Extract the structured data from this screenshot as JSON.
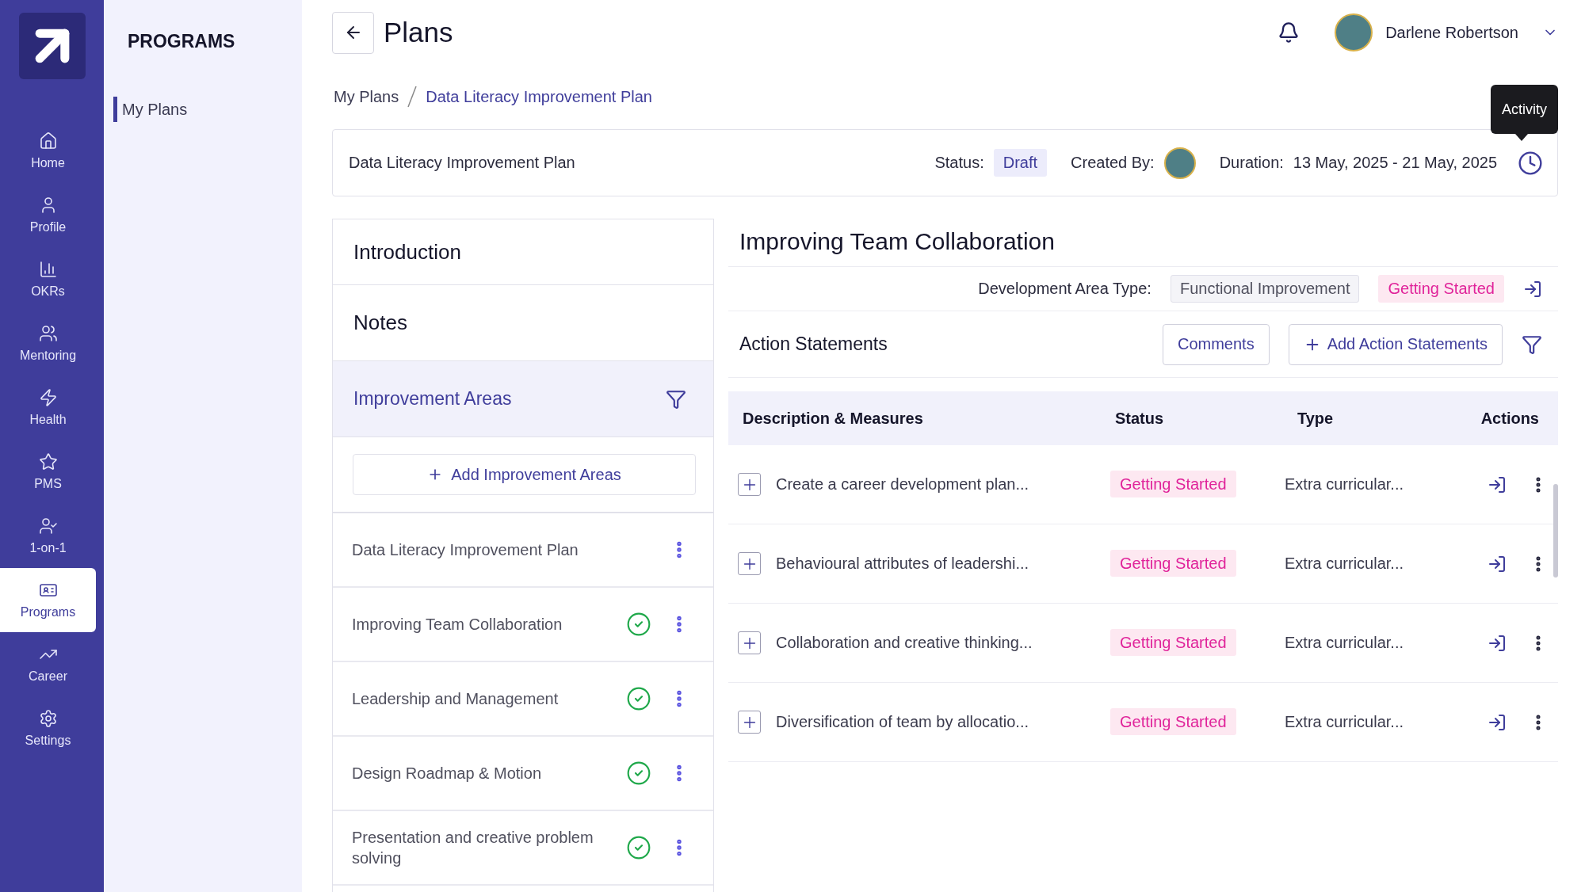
{
  "nav": [
    {
      "label": "Home",
      "selected": false
    },
    {
      "label": "Profile",
      "selected": false
    },
    {
      "label": "OKRs",
      "selected": false
    },
    {
      "label": "Mentoring",
      "selected": false
    },
    {
      "label": "Health",
      "selected": false
    },
    {
      "label": "PMS",
      "selected": false
    },
    {
      "label": "1-on-1",
      "selected": false
    },
    {
      "label": "Programs",
      "selected": true
    },
    {
      "label": "Career",
      "selected": false
    },
    {
      "label": "Settings",
      "selected": false
    }
  ],
  "programs_panel": {
    "title": "PROGRAMS",
    "items": [
      {
        "label": "My Plans",
        "selected": true
      }
    ]
  },
  "header": {
    "title": "Plans",
    "user_name": "Darlene Robertson"
  },
  "breadcrumb": [
    "My Plans",
    "Data Literacy Improvement Plan"
  ],
  "tooltip": "Activity",
  "plan_card": {
    "name": "Data Literacy Improvement Plan",
    "status_label": "Status:",
    "status": "Draft",
    "created_by_label": "Created By:",
    "duration_label": "Duration:",
    "duration": "13 May, 2025 - 21 May, 2025"
  },
  "sections": [
    {
      "label": "Introduction",
      "selected": false
    },
    {
      "label": "Notes",
      "selected": false
    },
    {
      "label": "Improvement Areas",
      "selected": true
    }
  ],
  "add_area_button": "Add Improvement Areas",
  "areas": [
    {
      "label": "Data Literacy Improvement Plan",
      "completed": false
    },
    {
      "label": "Improving Team Collaboration",
      "completed": true
    },
    {
      "label": "Leadership and Management",
      "completed": true
    },
    {
      "label": "Design Roadmap & Motion",
      "completed": true
    },
    {
      "label": "Presentation and creative problem solving",
      "completed": true
    }
  ],
  "detail": {
    "title": "Improving Team Collaboration",
    "type_label": "Development Area Type:",
    "type": "Functional Improvement",
    "status": "Getting Started",
    "section_title": "Action Statements",
    "comments_button": "Comments",
    "add_button": "Add Action Statements",
    "columns": [
      "Description & Measures",
      "Status",
      "Type",
      "Actions"
    ],
    "rows": [
      {
        "description": "Create a career development plan...",
        "status": "Getting Started",
        "type": "Extra curricular..."
      },
      {
        "description": "Behavioural attributes of leadershi...",
        "status": "Getting Started",
        "type": "Extra curricular..."
      },
      {
        "description": "Collaboration and creative thinking...",
        "status": "Getting Started",
        "type": "Extra curricular..."
      },
      {
        "description": "Diversification of team by allocatio...",
        "status": "Getting Started",
        "type": "Extra curricular..."
      }
    ]
  }
}
